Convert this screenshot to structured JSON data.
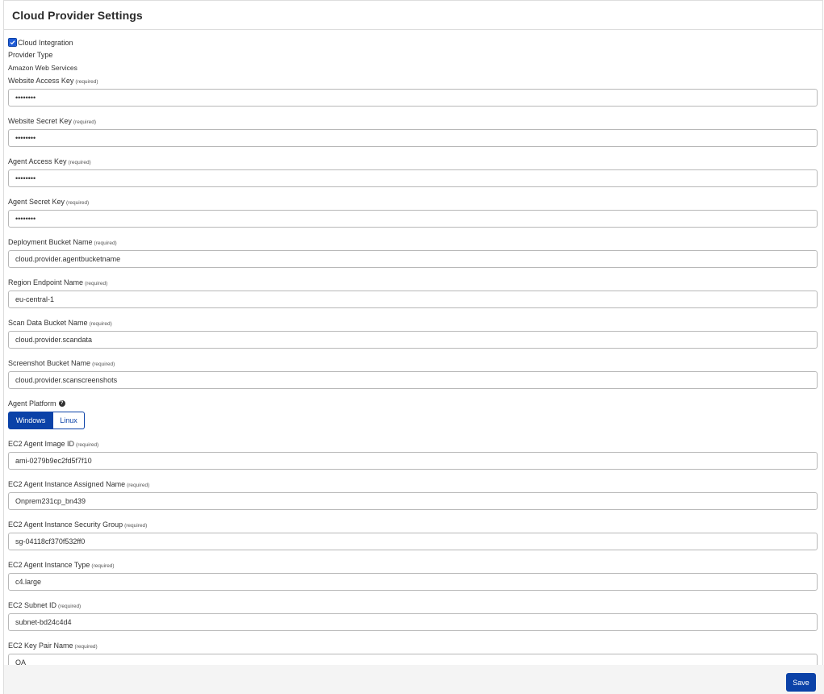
{
  "header": {
    "title": "Cloud Provider Settings"
  },
  "cloud_integration": {
    "label": "Cloud Integration",
    "checked": true
  },
  "provider": {
    "label": "Provider Type",
    "value": "Amazon Web Services"
  },
  "required_text": "(required)",
  "fields": [
    {
      "label": "Website Access Key",
      "value": "••••••••"
    },
    {
      "label": "Website Secret Key",
      "value": "••••••••"
    },
    {
      "label": "Agent Access Key",
      "value": "••••••••"
    },
    {
      "label": "Agent Secret Key",
      "value": "••••••••"
    },
    {
      "label": "Deployment Bucket Name",
      "value": "cloud.provider.agentbucketname"
    },
    {
      "label": "Region Endpoint Name",
      "value": "eu-central-1"
    },
    {
      "label": "Scan Data Bucket Name",
      "value": "cloud.provider.scandata"
    },
    {
      "label": "Screenshot Bucket Name",
      "value": "cloud.provider.scanscreenshots"
    }
  ],
  "platform": {
    "label": "Agent Platform",
    "options": [
      "Windows",
      "Linux"
    ],
    "selected": "Windows"
  },
  "ec2_fields": [
    {
      "label": "EC2 Agent Image ID",
      "value": "ami-0279b9ec2fd5f7f10"
    },
    {
      "label": "EC2 Agent Instance Assigned Name",
      "value": "Onprem231cp_bn439"
    },
    {
      "label": "EC2 Agent Instance Security Group",
      "value": "sg-04118cf370f532ff0"
    },
    {
      "label": "EC2 Agent Instance Type",
      "value": "c4.large"
    },
    {
      "label": "EC2 Subnet ID",
      "value": "subnet-bd24c4d4"
    },
    {
      "label": "EC2 Key Pair Name",
      "value": "QA"
    }
  ],
  "footer": {
    "save_label": "Save"
  },
  "colors": {
    "primary": "#0b42a8",
    "border": "#b8b8b8",
    "footer_bg": "#f4f4f4"
  },
  "icons": {
    "help": "question-circle-icon",
    "checkbox": "checkmark-icon"
  }
}
